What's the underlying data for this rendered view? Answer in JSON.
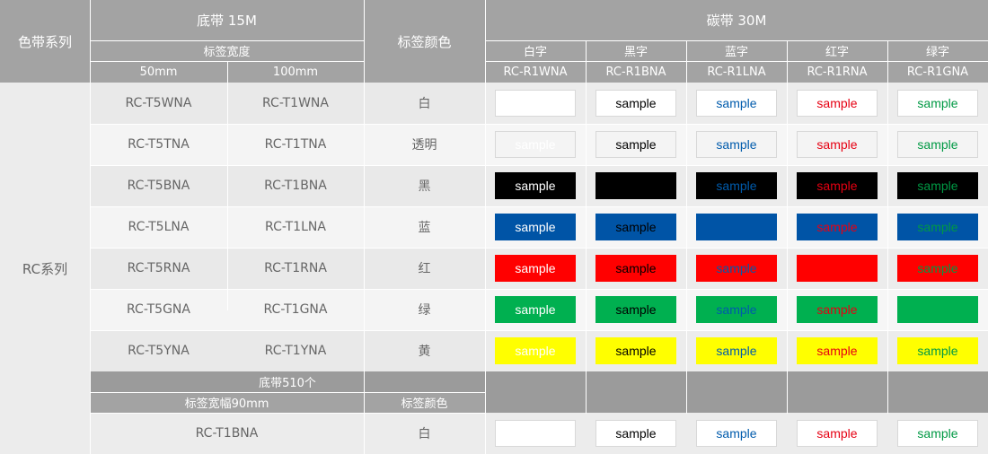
{
  "header": {
    "series": "色带系列",
    "base_tape": "底带 15M",
    "label_width": "标签宽度",
    "widths": [
      "50mm",
      "100mm"
    ],
    "label_color": "标签颜色",
    "carbon": "碳带 30M",
    "ink_names": [
      "白字",
      "黑字",
      "蓝字",
      "红字",
      "绿字"
    ],
    "ribbon_codes": [
      "RC-R1WNA",
      "RC-R1BNA",
      "RC-R1LNA",
      "RC-R1RNA",
      "RC-R1GNA"
    ]
  },
  "group_label": "RC系列",
  "sample_text": "sample",
  "ink_colors": [
    "#ffffff",
    "#000000",
    "#005bac",
    "#e60012",
    "#009944"
  ],
  "rows": [
    {
      "code50": "RC-T5WNA",
      "code100": "RC-T1WNA",
      "color_name": "白",
      "bg": "#ffffff",
      "border": true,
      "blank": 0
    },
    {
      "code50": "RC-T5TNA",
      "code100": "RC-T1TNA",
      "color_name": "透明",
      "bg": "#f4f4f4",
      "border": true,
      "blank": -1
    },
    {
      "code50": "RC-T5BNA",
      "code100": "RC-T1BNA",
      "color_name": "黑",
      "bg": "#000000",
      "border": false,
      "blank": 1
    },
    {
      "code50": "RC-T5LNA",
      "code100": "RC-T1LNA",
      "color_name": "蓝",
      "bg": "#0054a6",
      "border": false,
      "blank": 2
    },
    {
      "code50": "RC-T5RNA",
      "code100": "RC-T1RNA",
      "color_name": "红",
      "bg": "#ff0000",
      "border": false,
      "blank": 3
    },
    {
      "code50": "RC-T5GNA",
      "code100": "RC-T1GNA",
      "color_name": "绿",
      "bg": "#00b050",
      "border": false,
      "blank": 4
    },
    {
      "code50": "RC-T5YNA",
      "code100": "RC-T1YNA",
      "color_name": "黄",
      "bg": "#ffff00",
      "border": false,
      "blank": -1
    }
  ],
  "footer": {
    "base_count": "底带510个",
    "label_width_90": "标签宽幅90mm",
    "label_color": "标签颜色",
    "code": "RC-T1BNA",
    "color_name": "白",
    "bg": "#ffffff",
    "border": true,
    "blank": 0
  }
}
